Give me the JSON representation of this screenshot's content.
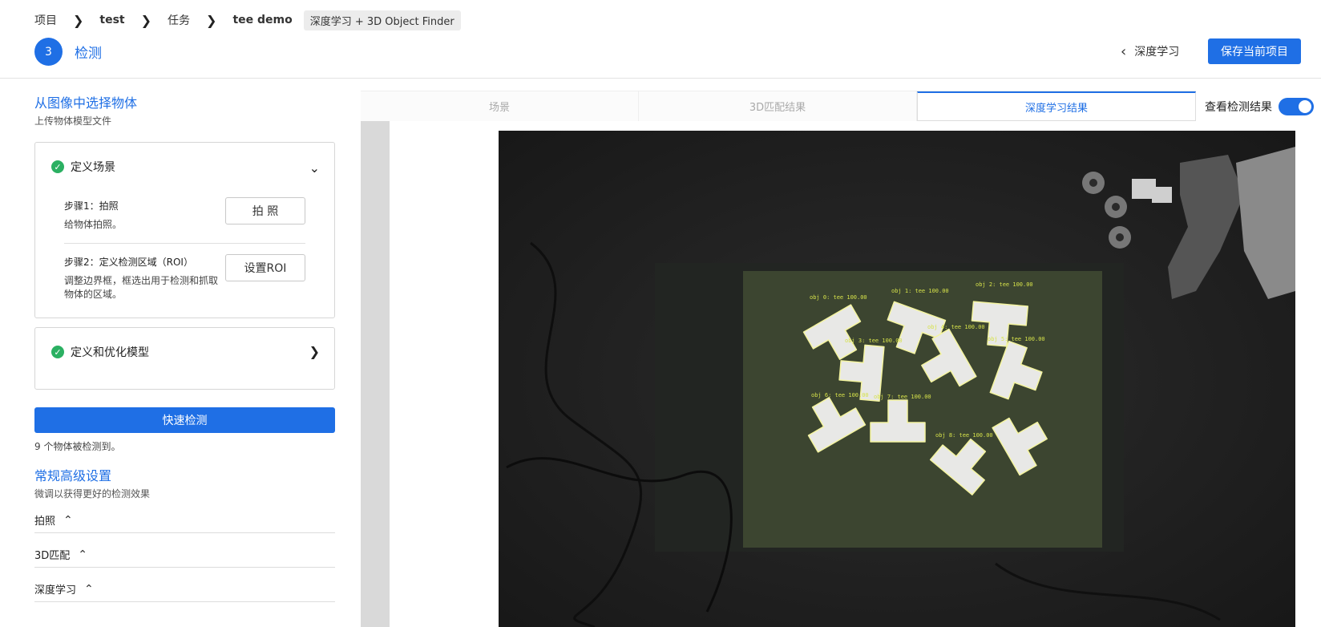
{
  "breadcrumb": {
    "items": [
      "项目",
      "test",
      "任务",
      "tee demo"
    ],
    "tag": "深度学习 + 3D Object Finder"
  },
  "step": {
    "number": "3",
    "title": "检测"
  },
  "header": {
    "back_label": "深度学习",
    "save_label": "保存当前项目"
  },
  "left": {
    "select_title": "从图像中选择物体",
    "select_sub": "上传物体模型文件",
    "scene_card": {
      "title": "定义场景",
      "step1_title": "步骤1：拍照",
      "step1_desc": "给物体拍照。",
      "step1_btn": "拍 照",
      "step2_title": "步骤2：定义检测区域（ROI）",
      "step2_desc": "调整边界框，框选出用于检测和抓取物体的区域。",
      "step2_btn": "设置ROI"
    },
    "model_card": {
      "title": "定义和优化模型"
    },
    "quick_detect_label": "快速检测",
    "detect_count_text": "9 个物体被检测到。",
    "advanced_title": "常规高级设置",
    "advanced_sub": "微调以获得更好的检测效果",
    "advanced_rows": [
      "拍照",
      "3D匹配",
      "深度学习"
    ]
  },
  "tabs": [
    "场景",
    "3D匹配结果",
    "深度学习结果"
  ],
  "active_tab": "深度学习结果",
  "toggle": {
    "label": "查看检测结果",
    "on": true
  },
  "detections": [
    {
      "label": "obj 0: tee 100.00"
    },
    {
      "label": "obj 1: tee 100.00"
    },
    {
      "label": "obj 2: tee 100.00"
    },
    {
      "label": "obj 3: tee 100.00"
    },
    {
      "label": "obj 4: tee 100.00"
    },
    {
      "label": "obj 5: tee 100.00"
    },
    {
      "label": "obj 6: tee 100.00"
    },
    {
      "label": "obj 7: tee 100.00"
    },
    {
      "label": "obj 8: tee 100.00"
    }
  ],
  "colors": {
    "accent": "#1f6fe5",
    "success": "#2bb062",
    "label": "#d6e24a"
  },
  "icons": {
    "crumb_separator": "chevron-right-icon",
    "back": "chevron-left-icon",
    "check": "check-circle-icon",
    "expand": "chevron-down-icon",
    "collapse": "chevron-right-icon",
    "adv_caret": "chevron-up-icon"
  }
}
